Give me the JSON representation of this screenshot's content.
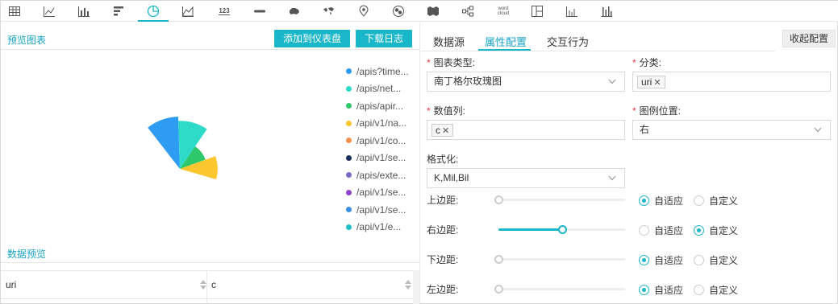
{
  "toolbar": {
    "icons": [
      "table-icon",
      "line-chart-icon",
      "bar-chart-icon",
      "horizontal-bar-icon",
      "pie-chart-icon",
      "area-chart-icon",
      "number-icon",
      "progress-icon",
      "china-map-icon",
      "world-map-icon",
      "location-icon",
      "chord-icon",
      "treemap-icon",
      "flow-icon",
      "wordcloud-icon",
      "layout-icon",
      "histogram-icon",
      "column-icon"
    ],
    "number_label": "123",
    "wordcloud_label": "word cloud",
    "active": "pie-chart-icon"
  },
  "left": {
    "preview_title": "预览图表",
    "add_dashboard": "添加到仪表盘",
    "download_log": "下载日志",
    "data_preview_title": "数据预览",
    "table": {
      "columns": [
        "uri",
        "c"
      ]
    }
  },
  "chart_data": {
    "type": "pie",
    "variant": "nightingale-rose",
    "legend_position": "right",
    "slices": [
      {
        "label": "/apis?time...",
        "color": "#2f9cf4",
        "value": 100
      },
      {
        "label": "/apis/net...",
        "color": "#2ddbc8",
        "value": 92
      },
      {
        "label": "/apis/apir...",
        "color": "#2ec86b",
        "value": 52
      },
      {
        "label": "/api/v1/na...",
        "color": "#fcc72e",
        "value": 72
      },
      {
        "label": "/api/v1/co...",
        "color": "#f68f4a",
        "value": 0
      },
      {
        "label": "/api/v1/se...",
        "color": "#1d2d5c",
        "value": 0
      },
      {
        "label": "/apis/exte...",
        "color": "#7b6bc8",
        "value": 0
      },
      {
        "label": "/api/v1/se...",
        "color": "#8e44c8",
        "value": 0
      },
      {
        "label": "/api/v1/se...",
        "color": "#3a8ee6",
        "value": 0
      },
      {
        "label": "/api/v1/e...",
        "color": "#1fc0c8",
        "value": 0
      }
    ]
  },
  "right": {
    "tabs": [
      "数据源",
      "属性配置",
      "交互行为"
    ],
    "collapse": "收起配置",
    "chart_type_label": "图表类型:",
    "chart_type_value": "南丁格尔玫瑰图",
    "category_label": "分类:",
    "category_tag": "uri",
    "value_col_label": "数值列:",
    "value_col_tag": "c",
    "legend_pos_label": "图例位置:",
    "legend_pos_value": "右",
    "format_label": "格式化:",
    "format_value": "K,Mil,Bil",
    "margins": [
      {
        "label": "上边距:",
        "mode": "auto",
        "level": 0
      },
      {
        "label": "右边距:",
        "mode": "custom",
        "level": 0.5
      },
      {
        "label": "下边距:",
        "mode": "auto",
        "level": 0
      },
      {
        "label": "左边距:",
        "mode": "auto",
        "level": 0
      }
    ],
    "auto_label": "自适应",
    "custom_label": "自定义",
    "accent": "#1ab6c9"
  }
}
